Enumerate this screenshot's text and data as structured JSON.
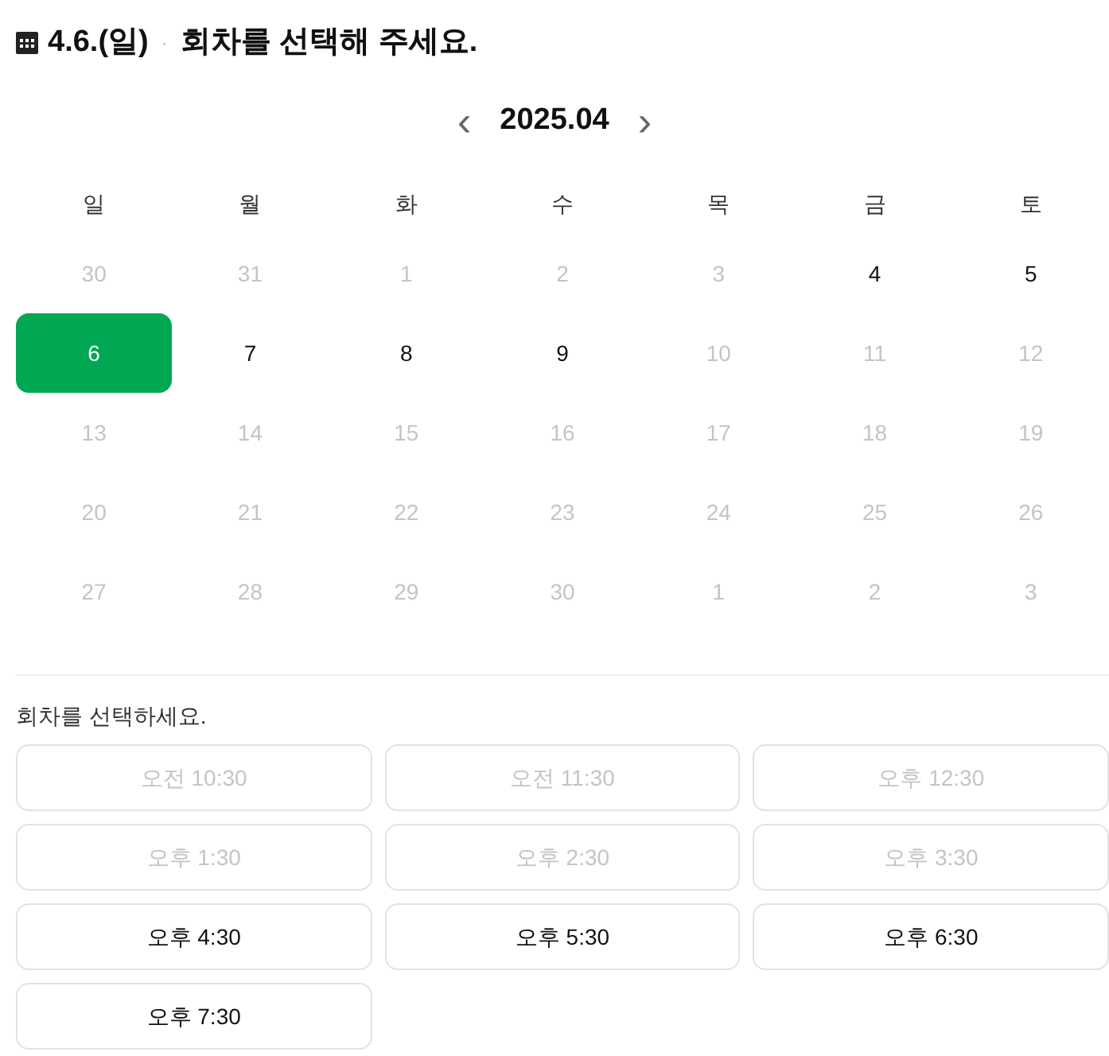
{
  "header": {
    "date": "4.6.(일)",
    "separator": "·",
    "title": "회차를 선택해 주세요."
  },
  "month_nav": {
    "prev": "‹",
    "month": "2025.04",
    "next": "›"
  },
  "weekdays": [
    "일",
    "월",
    "화",
    "수",
    "목",
    "금",
    "토"
  ],
  "days": [
    {
      "label": "30",
      "disabled": true,
      "selected": false
    },
    {
      "label": "31",
      "disabled": true,
      "selected": false
    },
    {
      "label": "1",
      "disabled": true,
      "selected": false
    },
    {
      "label": "2",
      "disabled": true,
      "selected": false
    },
    {
      "label": "3",
      "disabled": true,
      "selected": false
    },
    {
      "label": "4",
      "disabled": false,
      "selected": false
    },
    {
      "label": "5",
      "disabled": false,
      "selected": false
    },
    {
      "label": "6",
      "disabled": false,
      "selected": true
    },
    {
      "label": "7",
      "disabled": false,
      "selected": false
    },
    {
      "label": "8",
      "disabled": false,
      "selected": false
    },
    {
      "label": "9",
      "disabled": false,
      "selected": false
    },
    {
      "label": "10",
      "disabled": true,
      "selected": false
    },
    {
      "label": "11",
      "disabled": true,
      "selected": false
    },
    {
      "label": "12",
      "disabled": true,
      "selected": false
    },
    {
      "label": "13",
      "disabled": true,
      "selected": false
    },
    {
      "label": "14",
      "disabled": true,
      "selected": false
    },
    {
      "label": "15",
      "disabled": true,
      "selected": false
    },
    {
      "label": "16",
      "disabled": true,
      "selected": false
    },
    {
      "label": "17",
      "disabled": true,
      "selected": false
    },
    {
      "label": "18",
      "disabled": true,
      "selected": false
    },
    {
      "label": "19",
      "disabled": true,
      "selected": false
    },
    {
      "label": "20",
      "disabled": true,
      "selected": false
    },
    {
      "label": "21",
      "disabled": true,
      "selected": false
    },
    {
      "label": "22",
      "disabled": true,
      "selected": false
    },
    {
      "label": "23",
      "disabled": true,
      "selected": false
    },
    {
      "label": "24",
      "disabled": true,
      "selected": false
    },
    {
      "label": "25",
      "disabled": true,
      "selected": false
    },
    {
      "label": "26",
      "disabled": true,
      "selected": false
    },
    {
      "label": "27",
      "disabled": true,
      "selected": false
    },
    {
      "label": "28",
      "disabled": true,
      "selected": false
    },
    {
      "label": "29",
      "disabled": true,
      "selected": false
    },
    {
      "label": "30",
      "disabled": true,
      "selected": false
    },
    {
      "label": "1",
      "disabled": true,
      "selected": false
    },
    {
      "label": "2",
      "disabled": true,
      "selected": false
    },
    {
      "label": "3",
      "disabled": true,
      "selected": false
    }
  ],
  "session_label": "회차를 선택하세요.",
  "sessions": [
    {
      "label": "오전 10:30",
      "disabled": true
    },
    {
      "label": "오전 11:30",
      "disabled": true
    },
    {
      "label": "오후 12:30",
      "disabled": true
    },
    {
      "label": "오후 1:30",
      "disabled": true
    },
    {
      "label": "오후 2:30",
      "disabled": true
    },
    {
      "label": "오후 3:30",
      "disabled": true
    },
    {
      "label": "오후 4:30",
      "disabled": false
    },
    {
      "label": "오후 5:30",
      "disabled": false
    },
    {
      "label": "오후 6:30",
      "disabled": false
    },
    {
      "label": "오후 7:30",
      "disabled": false
    }
  ]
}
